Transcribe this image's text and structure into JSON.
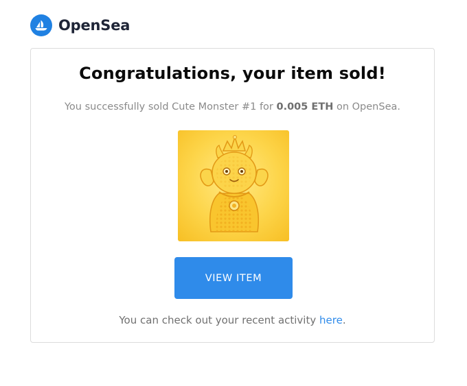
{
  "brand": {
    "name": "OpenSea",
    "logo_icon": "opensea-boat-icon",
    "color": "#2081e2"
  },
  "email": {
    "headline": "Congratulations, your item sold!",
    "message_prefix": "You successfully sold Cute Monster #1 for",
    "price": "0.005 ETH",
    "message_suffix": "on OpenSea.",
    "item_image_icon": "cute-monster-nft-image",
    "button_label": "VIEW ITEM",
    "button_color": "#2f8bea",
    "footer_prefix": "You can check out your recent activity",
    "footer_link": "here",
    "footer_suffix": "."
  }
}
